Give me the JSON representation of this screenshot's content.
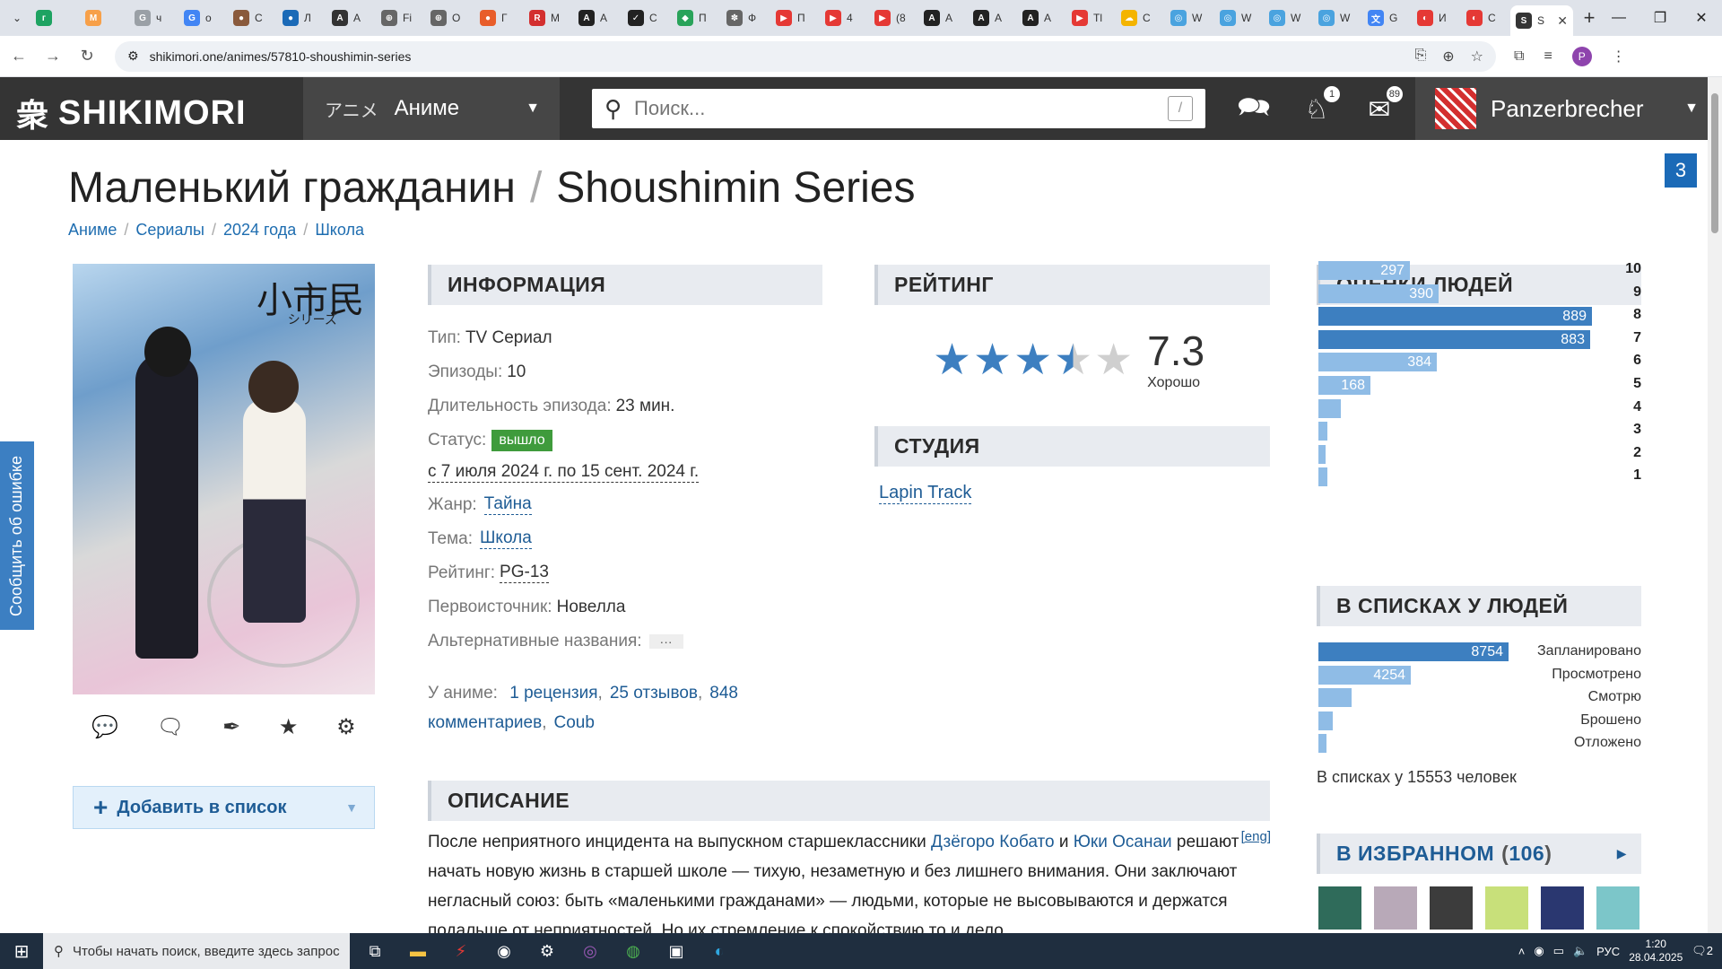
{
  "browser": {
    "tabs": [
      {
        "label": "",
        "color": "#1ea362",
        "glyph": "г"
      },
      {
        "label": "",
        "color": "#f7a049",
        "glyph": "M"
      },
      {
        "label": "ч",
        "color": "#9aa0a6",
        "glyph": "G"
      },
      {
        "label": "o",
        "color": "#4285f4",
        "glyph": "G"
      },
      {
        "label": "C",
        "color": "#8a5a3c",
        "glyph": "●"
      },
      {
        "label": "Л",
        "color": "#1b6ab7",
        "glyph": "●"
      },
      {
        "label": "A",
        "color": "#333333",
        "glyph": "A"
      },
      {
        "label": "Fi",
        "color": "#666666",
        "glyph": "⊕"
      },
      {
        "label": "O",
        "color": "#666666",
        "glyph": "⊕"
      },
      {
        "label": "Г",
        "color": "#e85d2a",
        "glyph": "●"
      },
      {
        "label": "M",
        "color": "#d32f2f",
        "glyph": "R"
      },
      {
        "label": "A",
        "color": "#222222",
        "glyph": "A"
      },
      {
        "label": "C",
        "color": "#222222",
        "glyph": "✓"
      },
      {
        "label": "П",
        "color": "#29a35a",
        "glyph": "◆"
      },
      {
        "label": "Ф",
        "color": "#666666",
        "glyph": "✽"
      },
      {
        "label": "П",
        "color": "#e53935",
        "glyph": "▶"
      },
      {
        "label": "4",
        "color": "#e53935",
        "glyph": "▶"
      },
      {
        "label": "(8",
        "color": "#e53935",
        "glyph": "▶"
      },
      {
        "label": "A",
        "color": "#222222",
        "glyph": "A"
      },
      {
        "label": "A",
        "color": "#222222",
        "glyph": "A"
      },
      {
        "label": "A",
        "color": "#222222",
        "glyph": "A"
      },
      {
        "label": "Tl",
        "color": "#e53935",
        "glyph": "▶"
      },
      {
        "label": "C",
        "color": "#f4b400",
        "glyph": "☁"
      },
      {
        "label": "W",
        "color": "#4aa3df",
        "glyph": "◎"
      },
      {
        "label": "W",
        "color": "#4aa3df",
        "glyph": "◎"
      },
      {
        "label": "W",
        "color": "#4aa3df",
        "glyph": "◎"
      },
      {
        "label": "W",
        "color": "#4aa3df",
        "glyph": "◎"
      },
      {
        "label": "G",
        "color": "#4285f4",
        "glyph": "文"
      },
      {
        "label": "И",
        "color": "#e53935",
        "glyph": "◐"
      },
      {
        "label": "C",
        "color": "#e53935",
        "glyph": "◐"
      }
    ],
    "active_tab": {
      "label": "S",
      "color": "#343434",
      "glyph": "S"
    },
    "url": "shikimori.one/animes/57810-shoushimin-series",
    "profile_initial": "P"
  },
  "header": {
    "logo_text": "SHIKIMORI",
    "menu_jp": "アニメ",
    "menu_label": "Аниме",
    "search_placeholder": "Поиск...",
    "search_hint": "/",
    "notifications_count": "1",
    "mail_count": "89",
    "username": "Panzerbrecher"
  },
  "page": {
    "report_label": "Сообщить об ошибке",
    "corner_number": "3",
    "title_ru": "Маленький гражданин",
    "title_sep": "/",
    "title_en": "Shoushimin Series",
    "breadcrumbs": [
      "Аниме",
      "Сериалы",
      "2024 года",
      "Школа"
    ],
    "breadcrumb_sep": "/",
    "poster_kanji": "小市民",
    "poster_sub": "シリーズ",
    "add_to_list": "Добавить в список"
  },
  "info": {
    "heading": "ИНФОРМАЦИЯ",
    "type_label": "Тип:",
    "type_value": "TV Сериал",
    "episodes_label": "Эпизоды:",
    "episodes_value": "10",
    "duration_label": "Длительность эпизода:",
    "duration_value": "23 мин.",
    "status_label": "Статус:",
    "status_value": "вышло",
    "status_color": "#3f9b3c",
    "dates": "с 7 июля 2024 г. по 15 сент. 2024 г.",
    "genre_label": "Жанр:",
    "genre_value": "Тайна",
    "theme_label": "Тема:",
    "theme_value": "Школа",
    "rating_label": "Рейтинг:",
    "rating_value": "PG-13",
    "source_label": "Первоисточник:",
    "source_value": "Новелла",
    "alt_label": "Альтернативные названия:",
    "alt_more": "···",
    "about_label": "У аниме:",
    "about_links": [
      "1 рецензия",
      "25 отзывов",
      "848 комментариев",
      "Coub"
    ]
  },
  "rating": {
    "heading": "РЕЙТИНГ",
    "score": "7.3",
    "score_text": "Хорошо",
    "stars_filled": 3.5,
    "stars_total": 5
  },
  "studio": {
    "heading": "СТУДИЯ",
    "name": "Lapin Track"
  },
  "description": {
    "heading": "ОПИСАНИЕ",
    "eng_link": "[eng]",
    "text_1": "После неприятного инцидента на выпускном старшеклассники ",
    "name_1": "Дзёгоро Кобато",
    "text_2": " и ",
    "name_2": "Юки Осанаи",
    "text_3": " решают начать новую жизнь в старшей школе — тихую, незаметную и без лишнего внимания. Они заключают негласный союз: быть «маленькими гражданами» — людьми, которые не высовываются и держатся подальше от неприятностей. Но их стремление к спокойствию то и дело"
  },
  "scores": {
    "heading": "ОЦЕНКИ ЛЮДЕЙ",
    "max": 889,
    "rows": [
      {
        "score": "10",
        "count": 297
      },
      {
        "score": "9",
        "count": 390
      },
      {
        "score": "8",
        "count": 889
      },
      {
        "score": "7",
        "count": 883
      },
      {
        "score": "6",
        "count": 384
      },
      {
        "score": "5",
        "count": 168
      },
      {
        "score": "4",
        "count": 72
      },
      {
        "score": "3",
        "count": 30
      },
      {
        "score": "2",
        "count": 20
      },
      {
        "score": "1",
        "count": 30
      }
    ]
  },
  "lists": {
    "heading": "В СПИСКАХ У ЛЮДЕЙ",
    "max": 8754,
    "rows": [
      {
        "label": "Запланировано",
        "count": 8754
      },
      {
        "label": "Просмотрено",
        "count": 4254
      },
      {
        "label": "Смотрю",
        "count": 1530
      },
      {
        "label": "Брошено",
        "count": 650
      },
      {
        "label": "Отложено",
        "count": 370
      }
    ],
    "total_text": "В списках у 15553 человек"
  },
  "favorites": {
    "heading": "В ИЗБРАННОМ",
    "count_open": "(",
    "count": "106",
    "count_close": ")",
    "thumb_colors": [
      "#2f6b5a",
      "#b8a9b8",
      "#3c3c3c",
      "#c8e07a",
      "#2a3770",
      "#7cc6c9"
    ]
  },
  "taskbar": {
    "search_text": "Чтобы начать поиск, введите здесь запрос",
    "lang": "РУС",
    "time": "1:20",
    "date": "28.04.2025",
    "notif_count": "2"
  }
}
